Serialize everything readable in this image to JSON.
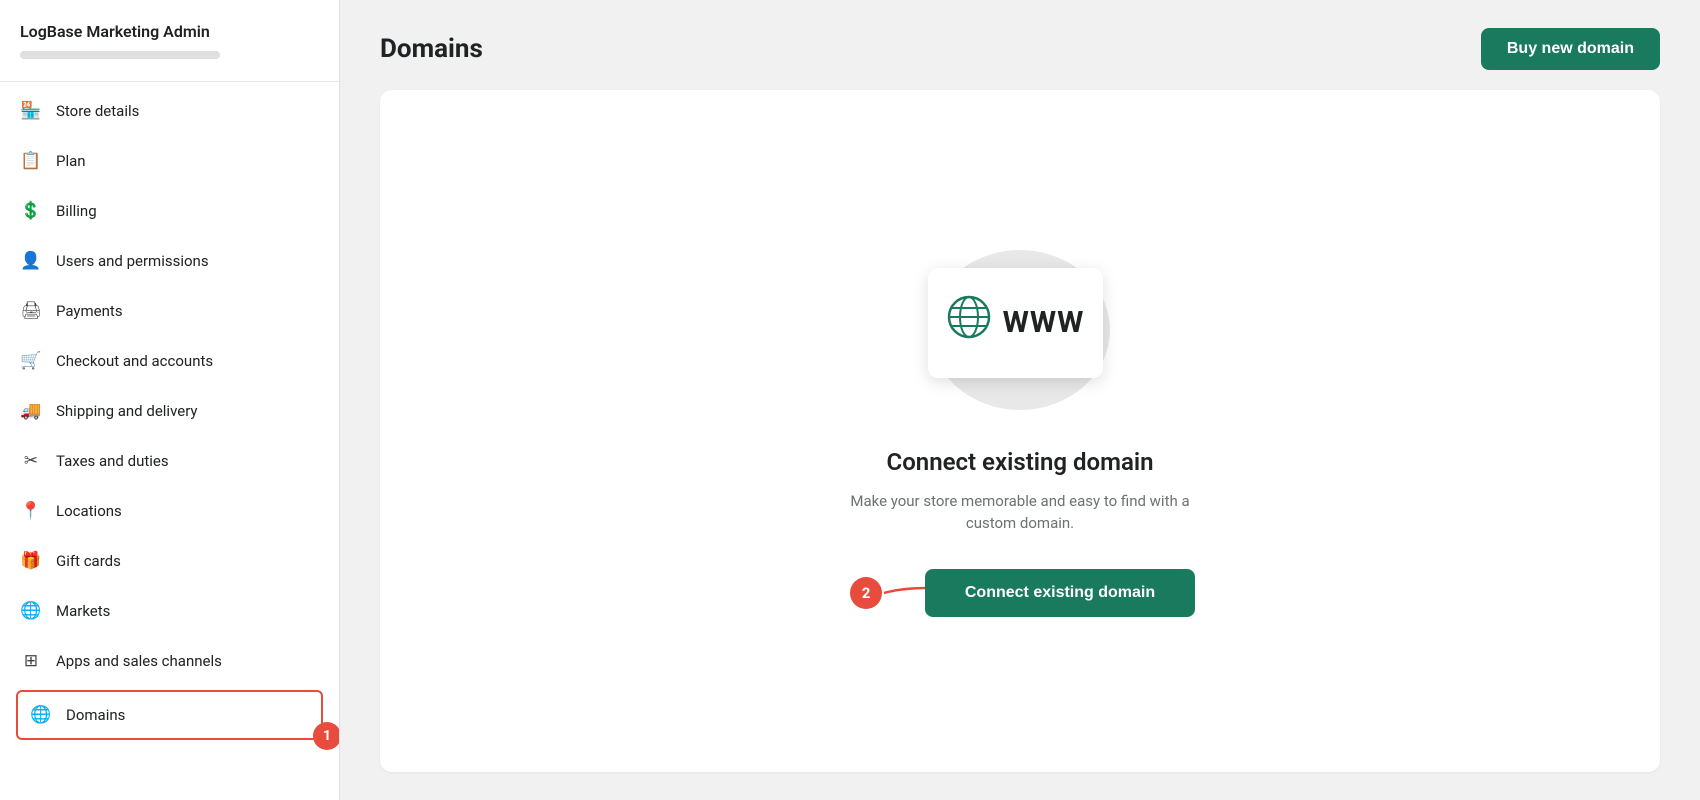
{
  "sidebar": {
    "store_name": "LogBase Marketing Admin",
    "items": [
      {
        "id": "store-details",
        "label": "Store details",
        "icon": "🏪",
        "active": false
      },
      {
        "id": "plan",
        "label": "Plan",
        "icon": "📋",
        "active": false
      },
      {
        "id": "billing",
        "label": "Billing",
        "icon": "💲",
        "active": false
      },
      {
        "id": "users-permissions",
        "label": "Users and permissions",
        "icon": "👤",
        "active": false
      },
      {
        "id": "payments",
        "label": "Payments",
        "icon": "🖨",
        "active": false
      },
      {
        "id": "checkout-accounts",
        "label": "Checkout and accounts",
        "icon": "🛒",
        "active": false
      },
      {
        "id": "shipping-delivery",
        "label": "Shipping and delivery",
        "icon": "🚚",
        "active": false
      },
      {
        "id": "taxes-duties",
        "label": "Taxes and duties",
        "icon": "✂",
        "active": false
      },
      {
        "id": "locations",
        "label": "Locations",
        "icon": "📍",
        "active": false
      },
      {
        "id": "gift-cards",
        "label": "Gift cards",
        "icon": "🎁",
        "active": false
      },
      {
        "id": "markets",
        "label": "Markets",
        "icon": "🌐",
        "active": false
      },
      {
        "id": "apps-sales-channels",
        "label": "Apps and sales channels",
        "icon": "⊞",
        "active": false
      },
      {
        "id": "domains",
        "label": "Domains",
        "icon": "🌐",
        "active": true
      }
    ],
    "badge_1": "1"
  },
  "header": {
    "title": "Domains",
    "buy_domain_label": "Buy new domain"
  },
  "main": {
    "connect_title": "Connect existing domain",
    "connect_desc": "Make your store memorable and easy to find with a custom domain.",
    "connect_button_label": "Connect existing domain",
    "www_label": "WWW",
    "annotation_badge_2": "2"
  }
}
